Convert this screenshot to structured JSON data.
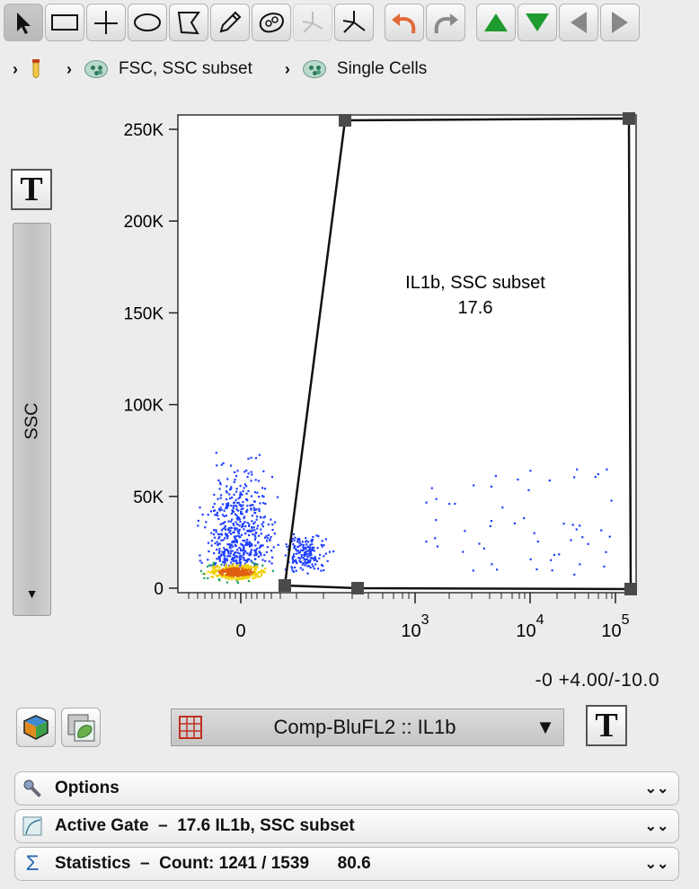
{
  "toolbar": {
    "tools": [
      "pointer",
      "rectangle-gate",
      "quadrant-gate",
      "ellipse-gate",
      "polygon-gate",
      "freehand-gate",
      "auto-gate",
      "spider-gate",
      "spider-gate-alt"
    ],
    "history": [
      "undo",
      "redo"
    ],
    "navigation": [
      "level-up",
      "level-down",
      "previous",
      "next"
    ]
  },
  "breadcrumb": {
    "items": [
      {
        "label": "",
        "icon": "tube-icon"
      },
      {
        "label": "FSC, SSC subset",
        "icon": "gate-icon"
      },
      {
        "label": "Single Cells",
        "icon": "gate-icon"
      }
    ]
  },
  "y_axis": {
    "label": "SSC",
    "text_button": "T"
  },
  "x_axis": {
    "parameter": "Comp-BluFL2 :: IL1b",
    "text_button": "T"
  },
  "transform_readout": "-0 +4.00/-10.0",
  "gate": {
    "name": "IL1b, SSC subset",
    "frequency": "17.6"
  },
  "chart_data": {
    "type": "scatter",
    "y_ticks": [
      "250K",
      "200K",
      "150K",
      "100K",
      "50K",
      "0"
    ],
    "y_tick_values": [
      250000,
      200000,
      150000,
      100000,
      50000,
      0
    ],
    "x_ticks": [
      {
        "base": "0",
        "exp": ""
      },
      {
        "base": "10",
        "exp": "3"
      },
      {
        "base": "10",
        "exp": "4"
      },
      {
        "base": "10",
        "exp": "5"
      }
    ],
    "x_scale": "biexponential",
    "ylim": [
      0,
      255000
    ],
    "gate_polygon": [
      [
        0.2,
        2000
      ],
      [
        0.48,
        255000
      ],
      [
        1.0,
        256000
      ],
      [
        1.0,
        0
      ],
      [
        0.57,
        300
      ]
    ],
    "colors": {
      "sparse": "#1f3fff",
      "mid": "#1aa05a",
      "dense": "#f0d000",
      "peak": "#e06010"
    }
  },
  "panels": [
    {
      "icon": "wrench-icon",
      "text": "Options"
    },
    {
      "icon": "gate-chart-icon",
      "text": "Active Gate  –  17.6 IL1b, SSC subset"
    },
    {
      "icon": "sigma-icon",
      "text": "Statistics  –  Count: 1241 / 1539      80.6"
    }
  ]
}
